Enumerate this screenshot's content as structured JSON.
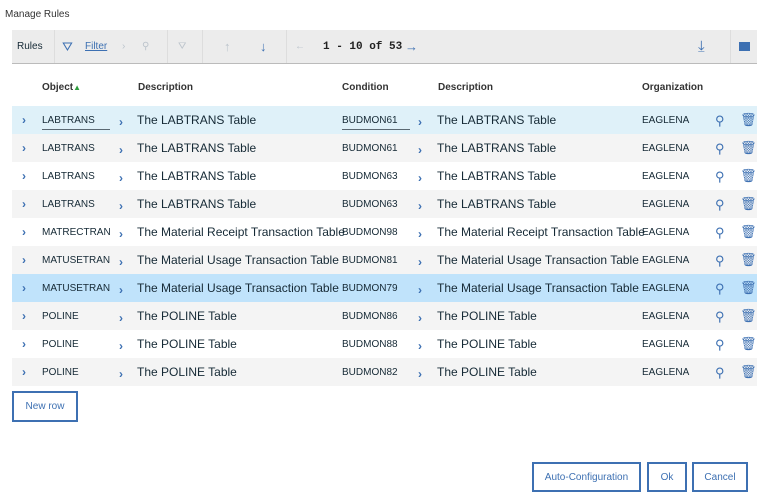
{
  "title": "Manage Rules",
  "toolbar": {
    "label": "Rules",
    "filter": "Filter",
    "pager": "1 - 10 of 53"
  },
  "headers": {
    "object": "Object",
    "description": "Description",
    "condition": "Condition",
    "description2": "Description",
    "organization": "Organization"
  },
  "rows": [
    {
      "object": "LABTRANS",
      "description": "The LABTRANS Table",
      "condition": "BUDMON61",
      "cond_description": "The LABTRANS Table",
      "org": "EAGLENA"
    },
    {
      "object": "LABTRANS",
      "description": "The LABTRANS Table",
      "condition": "BUDMON61",
      "cond_description": "The LABTRANS Table",
      "org": "EAGLENA"
    },
    {
      "object": "LABTRANS",
      "description": "The LABTRANS Table",
      "condition": "BUDMON63",
      "cond_description": "The LABTRANS Table",
      "org": "EAGLENA"
    },
    {
      "object": "LABTRANS",
      "description": "The LABTRANS Table",
      "condition": "BUDMON63",
      "cond_description": "The LABTRANS Table",
      "org": "EAGLENA"
    },
    {
      "object": "MATRECTRANS",
      "description": "The Material Receipt Transaction Table",
      "condition": "BUDMON98",
      "cond_description": "The Material Receipt Transaction Table",
      "org": "EAGLENA"
    },
    {
      "object": "MATUSETRANS",
      "description": "The Material Usage Transaction Table",
      "condition": "BUDMON81",
      "cond_description": "The Material Usage Transaction Table",
      "org": "EAGLENA"
    },
    {
      "object": "MATUSETRANS",
      "description": "The Material Usage Transaction Table",
      "condition": "BUDMON79",
      "cond_description": "The Material Usage Transaction Table",
      "org": "EAGLENA"
    },
    {
      "object": "POLINE",
      "description": "The POLINE Table",
      "condition": "BUDMON86",
      "cond_description": "The POLINE Table",
      "org": "EAGLENA"
    },
    {
      "object": "POLINE",
      "description": "The POLINE Table",
      "condition": "BUDMON88",
      "cond_description": "The POLINE Table",
      "org": "EAGLENA"
    },
    {
      "object": "POLINE",
      "description": "The POLINE Table",
      "condition": "BUDMON82",
      "cond_description": "The POLINE Table",
      "org": "EAGLENA"
    }
  ],
  "buttons": {
    "new_row": "New row",
    "auto_config": "Auto-Configuration",
    "ok": "Ok",
    "cancel": "Cancel"
  },
  "colors": {
    "accent": "#3d70b2",
    "row_focus": "#dff1f9",
    "row_selected": "#c0e3fb",
    "row_alt": "#f4f4f4",
    "sort_indicator": "#2e9e3e"
  },
  "icons": [
    "filter-icon",
    "chevron-right-icon",
    "search-icon",
    "clear-filter-icon",
    "arrow-up-icon",
    "arrow-down-icon",
    "arrow-left-icon",
    "arrow-right-icon",
    "download-icon",
    "collapse-icon",
    "trash-icon"
  ]
}
